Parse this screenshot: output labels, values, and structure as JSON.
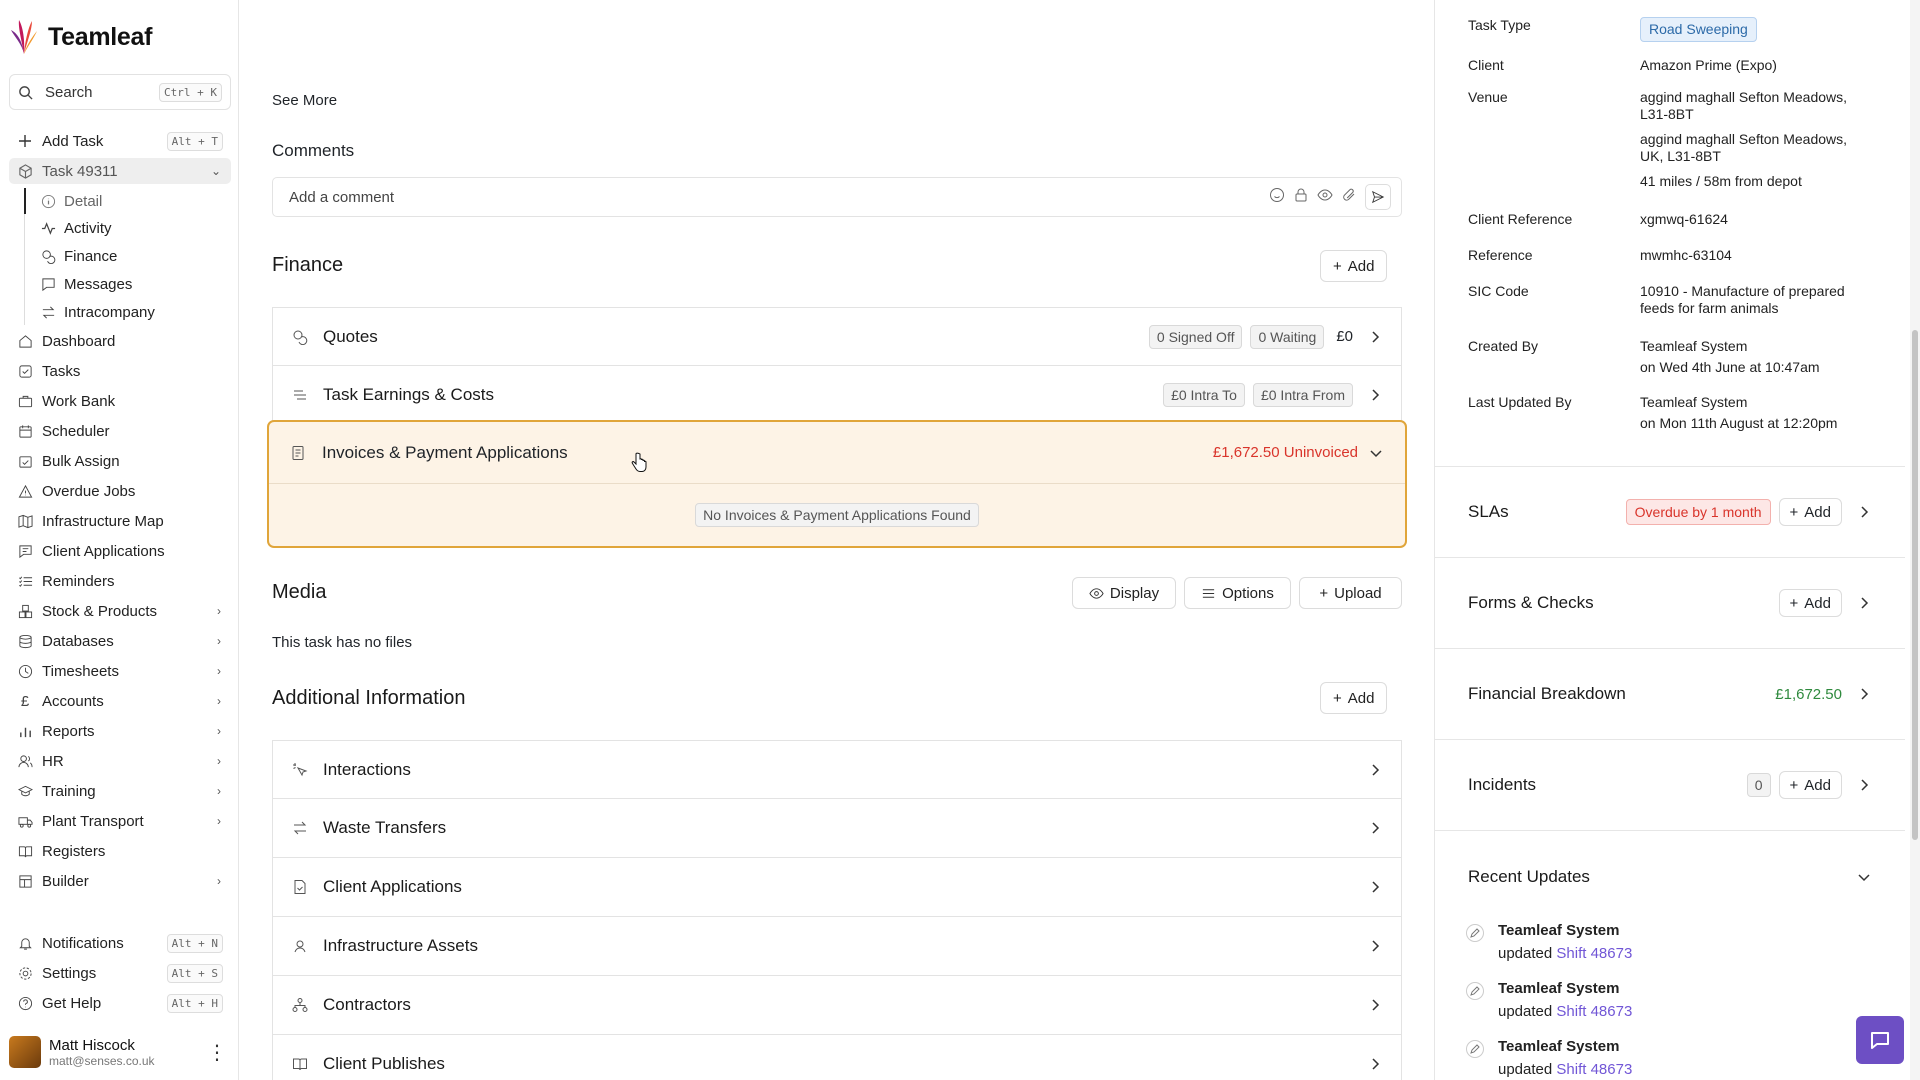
{
  "app": {
    "name": "Teamleaf"
  },
  "search": {
    "label": "Search",
    "shortcut": "Ctrl + K"
  },
  "sidebar": {
    "add_task": {
      "label": "Add Task",
      "shortcut": "Alt + T"
    },
    "task": {
      "label": "Task 49311"
    },
    "task_subitems": [
      "Detail",
      "Activity",
      "Finance",
      "Messages",
      "Intracompany"
    ],
    "items": [
      "Dashboard",
      "Tasks",
      "Work Bank",
      "Scheduler",
      "Bulk Assign",
      "Overdue Jobs",
      "Infrastructure Map",
      "Client Applications",
      "Reminders",
      "Stock & Products",
      "Databases",
      "Timesheets",
      "Accounts",
      "Reports",
      "HR",
      "Training",
      "Plant Transport",
      "Registers",
      "Builder"
    ],
    "bottom": [
      {
        "label": "Notifications",
        "shortcut": "Alt + N"
      },
      {
        "label": "Settings",
        "shortcut": "Alt + S"
      },
      {
        "label": "Get Help",
        "shortcut": "Alt + H"
      }
    ],
    "user": {
      "name": "Matt Hiscock",
      "email": "matt@senses.co.uk"
    }
  },
  "main": {
    "see_more": "See More",
    "comments": {
      "title": "Comments",
      "placeholder": "Add a comment"
    },
    "finance": {
      "title": "Finance",
      "add_label": "Add",
      "quotes": {
        "label": "Quotes",
        "signed_off": "0 Signed Off",
        "waiting": "0 Waiting",
        "total": "£0"
      },
      "earnings": {
        "label": "Task Earnings & Costs",
        "intra_to": "£0 Intra To",
        "intra_from": "£0 Intra From"
      },
      "invoices": {
        "label": "Invoices & Payment Applications",
        "uninvoiced": "£1,672.50 Uninvoiced",
        "empty": "No Invoices & Payment Applications Found"
      }
    },
    "media": {
      "title": "Media",
      "display": "Display",
      "options": "Options",
      "upload": "Upload",
      "empty": "This task has no files"
    },
    "additional": {
      "title": "Additional Information",
      "add_label": "Add",
      "rows": [
        "Interactions",
        "Waste Transfers",
        "Client Applications",
        "Infrastructure Assets",
        "Contractors",
        "Client Publishes"
      ]
    }
  },
  "details": {
    "task_type": {
      "label": "Task Type",
      "value": "Road Sweeping"
    },
    "client": {
      "label": "Client",
      "value": "Amazon Prime (Expo)"
    },
    "venue": {
      "label": "Venue",
      "line1": "aggind maghall Sefton Meadows, L31-8BT",
      "line2": "aggind maghall Sefton Meadows, UK, L31-8BT",
      "distance": "41 miles / 58m from depot"
    },
    "client_reference": {
      "label": "Client Reference",
      "value": "xgmwq-61624"
    },
    "reference": {
      "label": "Reference",
      "value": "mwmhc-63104"
    },
    "sic_code": {
      "label": "SIC Code",
      "value": "10910 - Manufacture of prepared feeds for farm animals"
    },
    "created_by": {
      "label": "Created By",
      "value": "Teamleaf System",
      "date": "on Wed 4th June at 10:47am"
    },
    "last_updated_by": {
      "label": "Last Updated By",
      "value": "Teamleaf System",
      "date": "on Mon 11th August at 12:20pm"
    }
  },
  "panels": {
    "slas": {
      "title": "SLAs",
      "status": "Overdue by 1 month",
      "add": "Add"
    },
    "forms": {
      "title": "Forms & Checks",
      "add": "Add"
    },
    "financial": {
      "title": "Financial Breakdown",
      "value": "£1,672.50"
    },
    "incidents": {
      "title": "Incidents",
      "count": "0",
      "add": "Add"
    },
    "recent": {
      "title": "Recent Updates"
    }
  },
  "updates": [
    {
      "name": "Teamleaf System",
      "action": "updated",
      "link": "Shift 48673"
    },
    {
      "name": "Teamleaf System",
      "action": "updated",
      "link": "Shift 48673"
    },
    {
      "name": "Teamleaf System",
      "action": "updated",
      "link": "Shift 48673"
    }
  ],
  "colors": {
    "accent": "#6d4fc4",
    "highlight_border": "#e0a53a",
    "highlight_bg": "#fdf3e6",
    "danger": "#d9342b",
    "success": "#2f8a3e"
  }
}
